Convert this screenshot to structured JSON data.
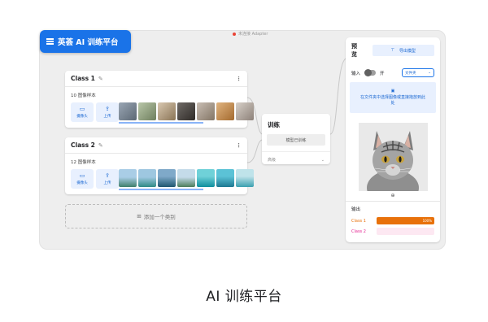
{
  "app": {
    "title": "英荟 AI 训练平台",
    "adapter_status": "未连接 Adapter"
  },
  "classes": [
    {
      "name": "Class 1",
      "samples": "10 图像样本",
      "webcam": "摄像头",
      "upload": "上传"
    },
    {
      "name": "Class 2",
      "samples": "12 图像样本",
      "webcam": "摄像头",
      "upload": "上传"
    }
  ],
  "add_class": "添加一个类别",
  "training": {
    "title": "训练",
    "button": "模型已训练",
    "advanced": "高级"
  },
  "preview": {
    "title": "预览",
    "export": "导出模型",
    "input_label": "输入",
    "toggle_state": "开",
    "source_select": "文件夹",
    "dropzone_text": "在文件夹中选择图像或直接拖放到此处",
    "output_label": "输出",
    "outputs": [
      {
        "name": "Class 1",
        "percent_label": "100%",
        "value": 1.0,
        "color": "#e8710a",
        "bg": "#fde7d2"
      },
      {
        "name": "Class 2",
        "percent_label": "",
        "value": 0.0,
        "color": "#e52592",
        "bg": "#fde8f2"
      }
    ]
  },
  "caption": "AI 训练平台",
  "icons": {
    "menu": "menu-icon",
    "pencil": "edit-icon",
    "kebab": "more-vert-icon",
    "webcam": "webcam-icon",
    "upload": "upload-icon",
    "export": "export-icon",
    "folder": "folder-upload-icon",
    "chevron": "chevron-down-icon",
    "plus": "add-box-icon"
  }
}
